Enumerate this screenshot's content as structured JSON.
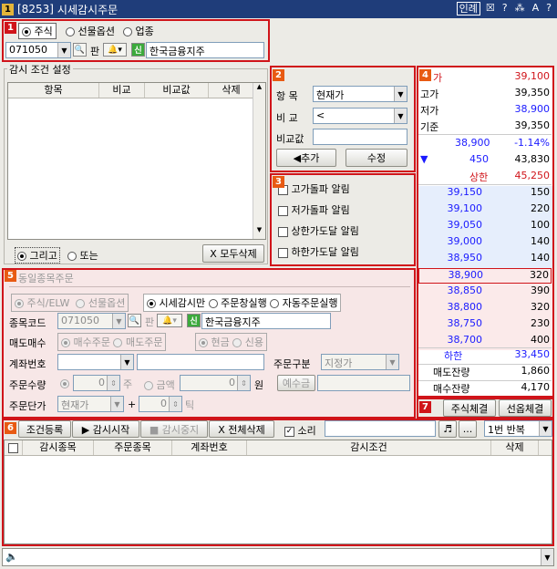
{
  "window": {
    "num": "1",
    "code": "[8253]",
    "title": "시세감시주문",
    "icon_labels": [
      "인례",
      "☒",
      "?",
      "⁂",
      "A",
      "?"
    ]
  },
  "s1": {
    "badge": "1",
    "radios": [
      "주식",
      "선물옵션",
      "업종"
    ],
    "selected": 0,
    "code": "071050",
    "code_btn": "판",
    "new_tag": "신",
    "stock_name": "한국금융지주"
  },
  "cond": {
    "title": "감시 조건 설정",
    "columns": [
      "항목",
      "비교",
      "비교값",
      "삭제"
    ],
    "radio_and": "그리고",
    "radio_or": "또는",
    "delete_all": "X 모두삭제"
  },
  "s2": {
    "badge": "2",
    "item_label": "항 목",
    "item_value": "현재가",
    "cmp_label": "비 교",
    "cmp_value": "<",
    "value_label": "비교값",
    "add_btn": "◀추가",
    "edit_btn": "수정"
  },
  "s3": {
    "badge": "3",
    "alerts": [
      "고가돌파 알림",
      "저가돌파 알림",
      "상한가도달 알림",
      "하한가도달 알림"
    ]
  },
  "s4": {
    "badge": "4",
    "summary": [
      {
        "label": "가",
        "value": "39,100"
      },
      {
        "label": "고가",
        "value": "39,350"
      },
      {
        "label": "저가",
        "value": "38,900"
      },
      {
        "label": "기준",
        "value": "39,350"
      }
    ],
    "current": "38,900",
    "change_pct": "-1.14%",
    "change": "450",
    "volume": "43,830",
    "upper_label": "상한",
    "upper": "45,250",
    "asks": [
      {
        "price": "39,150",
        "qty": "150"
      },
      {
        "price": "39,100",
        "qty": "220"
      },
      {
        "price": "39,050",
        "qty": "100"
      },
      {
        "price": "39,000",
        "qty": "140"
      },
      {
        "price": "38,950",
        "qty": "140"
      }
    ],
    "bids": [
      {
        "price": "38,900",
        "qty": "320"
      },
      {
        "price": "38,850",
        "qty": "390"
      },
      {
        "price": "38,800",
        "qty": "320"
      },
      {
        "price": "38,750",
        "qty": "230"
      },
      {
        "price": "38,700",
        "qty": "400"
      }
    ],
    "lower_label": "하한",
    "lower": "33,450",
    "ask_total_label": "매도잔량",
    "ask_total": "1,860",
    "bid_total_label": "매수잔량",
    "bid_total": "4,170"
  },
  "s5": {
    "badge": "5",
    "title": "동일종목주문",
    "radios1": [
      "주식/ELW",
      "선물옵션"
    ],
    "radios2": [
      "시세감시만",
      "주문창실행",
      "자동주문실행"
    ],
    "code_label": "종목코드",
    "code": "071050",
    "code_btn": "판",
    "new_tag": "신",
    "stock_name": "한국금융지주",
    "side_label": "매도매수",
    "side_opts": [
      "매수주문",
      "매도주문"
    ],
    "cash_opts": [
      "현금",
      "신용"
    ],
    "acct_label": "계좌번호",
    "order_type_label": "주문구분",
    "order_type": "지정가",
    "qty_label": "주문수량",
    "qty": "0",
    "qty_unit": "주",
    "amount_label": "금액",
    "amount": "0",
    "amount_unit": "원",
    "deposit_btn": "예수금",
    "price_label": "주문단가",
    "price_type": "현재가",
    "plus": "+",
    "tick": "0",
    "tick_unit": "틱"
  },
  "s6": {
    "badge": "6",
    "buttons": [
      "조건등록",
      "▶ 감시시작",
      "■ 감시중지",
      "X 전체삭제"
    ],
    "sound_label": "소리",
    "repeat": "1번 반복",
    "note": "♬",
    "more": "...",
    "columns": [
      "감시종목",
      "주문종목",
      "계좌번호",
      "감시조건",
      "삭제"
    ]
  },
  "s7": {
    "badge": "7",
    "btn1": "주식체결",
    "btn2": "선옵체결"
  },
  "colors": {
    "red": "#d0141a",
    "blue": "#1a1aff",
    "title": "#1f3d7a",
    "ask_bg": "#e6eefc",
    "bid_bg": "#fbeaea"
  }
}
